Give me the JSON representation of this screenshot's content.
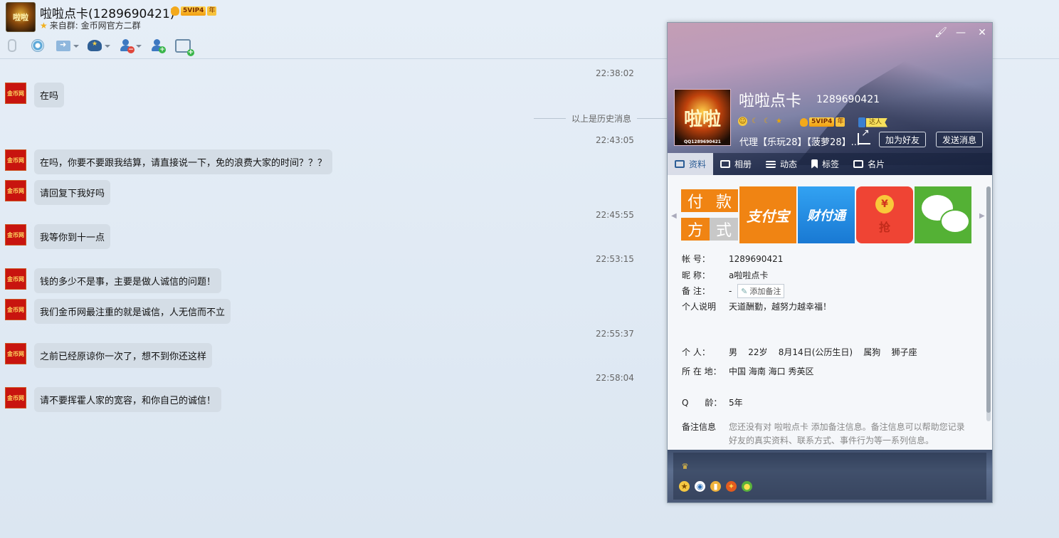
{
  "header": {
    "title": "啦啦点卡(1289690421)",
    "avatar_text": "啦啦",
    "vip_level": "5VIP4",
    "vip_year": "年",
    "from_label": "来自群:",
    "from_group": "金币网官方二群",
    "toolbar": [
      "mic-icon",
      "camera-icon",
      "send-file-icon",
      "police-icon",
      "remove-user-icon",
      "add-user-icon",
      "new-message-icon"
    ]
  },
  "chat": {
    "history_divider": "以上是历史消息",
    "avatar_text": "金币网",
    "timestamps": [
      "22:38:02",
      "22:43:05",
      "22:45:55",
      "22:53:15",
      "22:55:37",
      "22:58:04"
    ],
    "messages": [
      "在吗",
      "在吗，你要不要跟我结算，请直接说一下，免的浪费大家的时间？？？",
      "请回复下我好吗",
      "我等你到十一点",
      "钱的多少不是事，主要是做人诚信的问题！",
      "我们金币网最注重的就是诚信，人无信而不立",
      "之前已经原谅你一次了，想不到你还这样",
      "请不要挥霍人家的宽容，和你自己的诚信！"
    ]
  },
  "profile": {
    "name": "啦啦点卡",
    "qq": "1289690421",
    "avatar_text": "啦啦",
    "avatar_caption": "QQ1289690421",
    "vip_level": "5VIP4",
    "vip_year": "年",
    "daren": "达人",
    "signature": "代理【乐玩28】【菠萝28】...",
    "add_friend": "加为好友",
    "send_message": "发送消息",
    "tabs": [
      "资料",
      "相册",
      "动态",
      "标签",
      "名片"
    ],
    "photos": {
      "pay": [
        "付",
        "款",
        "方",
        "式"
      ],
      "alipay": "支付宝",
      "tenpay": "财付通",
      "hongbao_coin": "¥",
      "hongbao_text": "抢"
    },
    "fields": {
      "account_label": "帐    号：",
      "account": "1289690421",
      "nickname_label": "昵    称：",
      "nickname": "a啦啦点卡",
      "remark_label": "备    注：",
      "remark": "-",
      "add_remark": "添加备注",
      "desc_label": "个人说明",
      "desc": "天道酬勤，越努力越幸福！",
      "personal_label": "个    人：",
      "personal": "男    22岁    8月14日(公历生日)    属狗    狮子座",
      "location_label": "所 在 地：",
      "location": "中国 海南 海口 秀英区",
      "qage_label": "Q      龄：",
      "qage": "5年",
      "note_label": "备注信息",
      "note_line1": "您还没有对 啦啦点卡 添加备注信息。备注信息可以帮助您记录",
      "note_line2": "好友的真实资料、联系方式、事件行为等一系列信息。"
    }
  }
}
